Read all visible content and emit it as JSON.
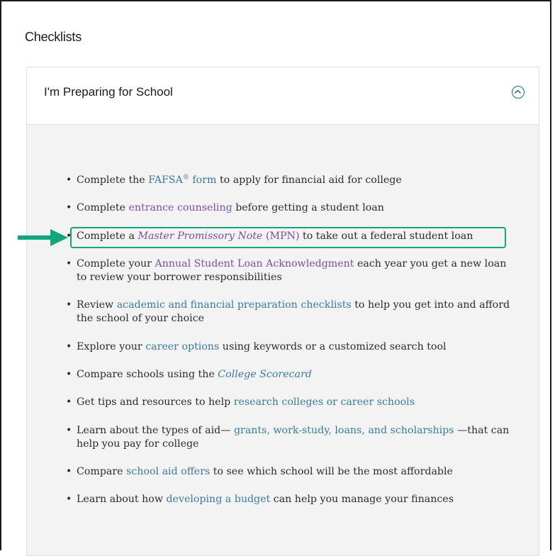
{
  "page": {
    "heading": "Checklists"
  },
  "section": {
    "title": "I'm Preparing for School",
    "toggle_icon": "chevron-up-circle-icon"
  },
  "items": [
    {
      "pre": "Complete the ",
      "link": "FAFSA",
      "sup": "®",
      "link2": " form",
      "post": "  to apply for financial aid for college"
    },
    {
      "pre": "Complete ",
      "link": "entrance counseling",
      "post": "  before getting a student loan"
    },
    {
      "pre": "Complete a ",
      "link": "Master Promissory Note",
      "link2": " (MPN)",
      "post": "  to take out a federal student loan"
    },
    {
      "pre": "Complete your ",
      "link": "Annual Student Loan Acknowledgment",
      "post": "  each year you get a new loan to review your borrower responsibilities"
    },
    {
      "pre": "Review ",
      "link": "academic and financial preparation checklists",
      "post": "  to help you get into and afford the school of your choice"
    },
    {
      "pre": "Explore your ",
      "link": "career options",
      "post": "  using keywords or a customized search tool"
    },
    {
      "pre": "Compare schools using the ",
      "link": "College Scorecard",
      "post": ""
    },
    {
      "pre": "Get tips and resources to help ",
      "link": "research colleges or career schools",
      "post": ""
    },
    {
      "pre": "Learn about the types of aid— ",
      "link": "grants, work-study, loans, and scholarships",
      "post": " —that can help you pay for college"
    },
    {
      "pre": "Compare ",
      "link": "school aid offers",
      "post": "  to see which school will be the most affordable"
    },
    {
      "pre": "Learn about how ",
      "link": "developing a budget",
      "post": "  can help you manage your finances"
    }
  ],
  "colors": {
    "link_blue": "#3a7aa0",
    "link_visited": "#7b4ea3",
    "highlight": "#12a67a",
    "accent": "#1a6d7f"
  }
}
